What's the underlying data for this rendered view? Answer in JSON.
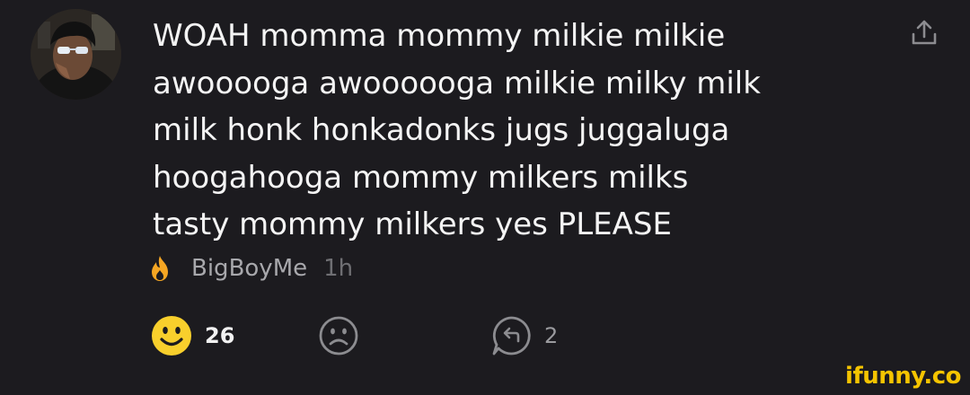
{
  "comment": {
    "text_lines": [
      "WOAH momma mommy milkie milkie",
      "awooooga awoooooga milkie milky milk",
      "milk honk honkadonks jugs juggaluga",
      "hoogahooga mommy milkers milks",
      "tasty mommy milkers yes PLEASE"
    ],
    "author": "BigBoyMe",
    "time": "1h",
    "smile_count": "26",
    "reply_count": "2"
  },
  "watermark": "ifunny.co",
  "icons": {
    "share": "share-icon",
    "flame": "flame-icon",
    "smile": "smile-icon",
    "frown": "frown-icon",
    "reply": "reply-icon"
  },
  "colors": {
    "background": "#1c1b1f",
    "text": "#f4f4f4",
    "author": "#a8a8ac",
    "time": "#6f6f73",
    "smile": "#f8cf2c",
    "flame": "#f5a623",
    "watermark": "#f5c400"
  }
}
